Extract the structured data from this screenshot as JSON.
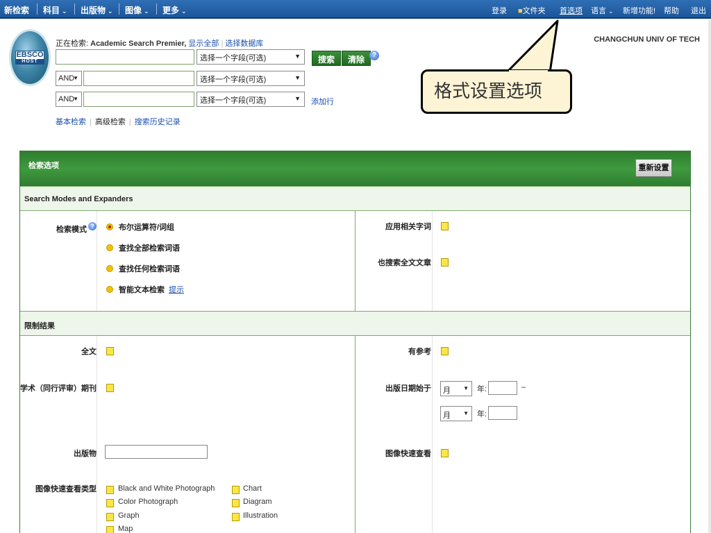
{
  "topnav": {
    "new_search": "新检索",
    "subjects": "科目",
    "publications": "出版物",
    "images": "图像",
    "more": "更多",
    "caret": "⌄",
    "signin": "登录",
    "folder": "文件夹",
    "preferences": "首选项",
    "language": "语言",
    "new_features": "新增功能!",
    "help": "帮助",
    "exit": "退出"
  },
  "logo": {
    "name": "EBSCO",
    "sub": "HOST"
  },
  "search": {
    "searching_label": "正在检索:",
    "database": "Academic Search Premier,",
    "show_all": "显示全部",
    "choose_db": "选择数据库",
    "field_placeholder": "选择一个字段(可选)",
    "bool_1": "AND",
    "bool_2": "AND",
    "search_btn": "搜索",
    "clear_btn": "清除",
    "add_row": "添加行",
    "basic": "基本检索",
    "advanced": "高级检索",
    "history": "搜索历史记录"
  },
  "institution": "CHANGCHUN UNIV OF TECH",
  "callout": "格式设置选项",
  "options": {
    "title": "检索选项",
    "reset": "重新设置",
    "modes_header": "Search Modes and Expanders",
    "search_mode_label": "检索模式",
    "modes": [
      "布尔运算符/词组",
      "查找全部检索词语",
      "查找任何检索词语",
      "智能文本检索"
    ],
    "hint_link": "提示",
    "apply_related": "应用相关字词",
    "also_fulltext": "也搜索全文文章",
    "limit_header": "限制结果",
    "fulltext": "全文",
    "references": "有参考",
    "scholarly": "学术（同行评审）期刊",
    "pubdate": "出版日期始于",
    "month": "月",
    "year": "年:",
    "dash": "–",
    "publication": "出版物",
    "image_quick": "图像快速查看",
    "image_types_label": "图像快速查看类型",
    "image_types_col1": [
      "Black and White Photograph",
      "Color Photograph",
      "Graph",
      "Map"
    ],
    "image_types_col2": [
      "Chart",
      "Diagram",
      "Illustration"
    ]
  }
}
